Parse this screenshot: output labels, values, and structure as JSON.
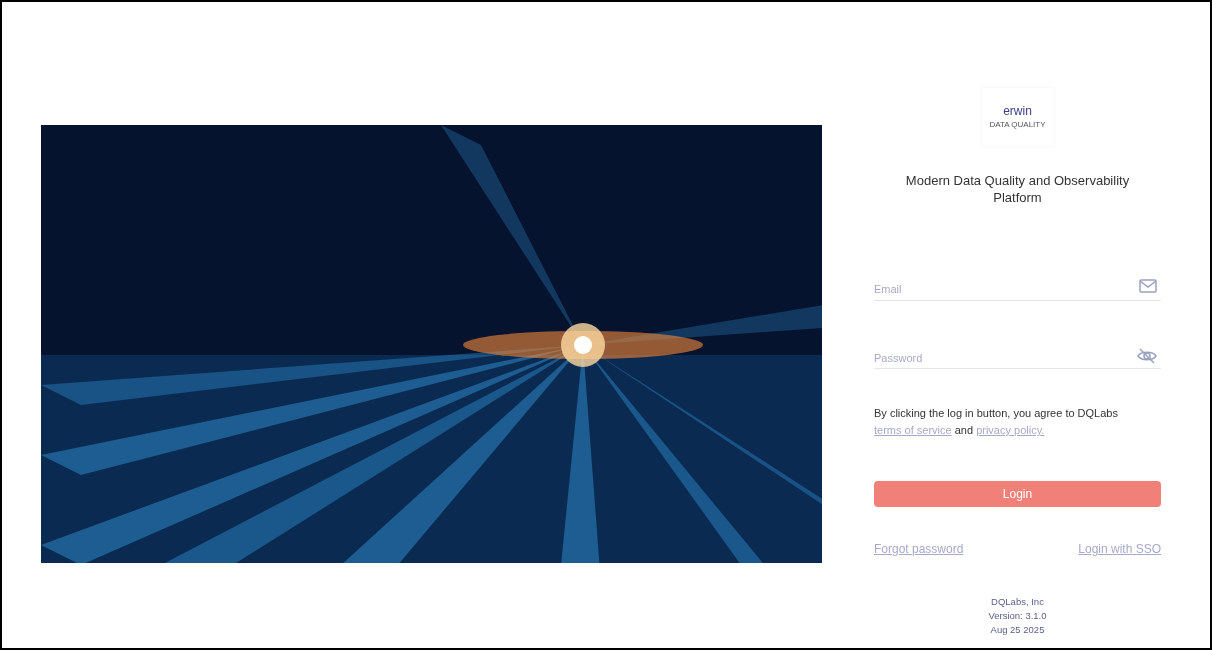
{
  "logo": {
    "name": "erwin",
    "subtitle": "DATA QUALITY"
  },
  "hero": {
    "kind": "picture"
  },
  "title": "Modern Data Quality and Observability Platform",
  "fields": [
    {
      "kind": "email",
      "placeholder": "Email"
    },
    {
      "kind": "password",
      "placeholder": "Password"
    }
  ],
  "agreement": {
    "text": "By clicking the log in button, you agree to DQLabs",
    "terms_link": "terms of service",
    "joiner": "and",
    "privacy_link": "privacy policy."
  },
  "login_button": "Login",
  "links": [
    "Forgot password",
    "Login with SSO"
  ],
  "footer": [
    "DQLabs, Inc",
    "Version: 3.1.0",
    "Aug 25 2025"
  ]
}
